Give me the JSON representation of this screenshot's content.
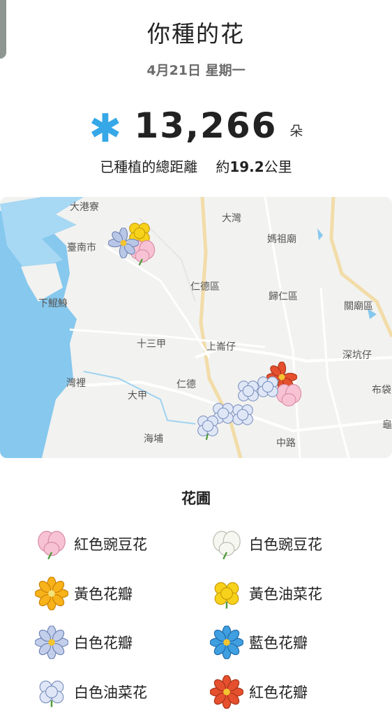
{
  "header": {
    "title": "你種的花",
    "date": "4月21日 星期一"
  },
  "stats": {
    "count": "13,266",
    "unit": "朵",
    "distance_label": "已種植的總距離",
    "distance_prefix": "約",
    "distance_value": "19.2",
    "distance_unit": "公里"
  },
  "map": {
    "labels": [
      "大港寮",
      "大灣",
      "臺南市",
      "媽祖廟",
      "仁德區",
      "下鯤鯓",
      "歸仁區",
      "關廟區",
      "十三甲",
      "上崙仔",
      "深坑仔",
      "灣裡",
      "仁德",
      "大甲",
      "布袋",
      "海埔",
      "中路",
      "龜"
    ]
  },
  "garden": {
    "title": "花圃",
    "items": [
      {
        "label": "紅色豌豆花",
        "icon": "pink-sweet-pea-icon"
      },
      {
        "label": "白色豌豆花",
        "icon": "white-sweet-pea-icon"
      },
      {
        "label": "黃色花瓣",
        "icon": "yellow-petal-flower-icon"
      },
      {
        "label": "黃色油菜花",
        "icon": "yellow-rapeseed-flower-icon"
      },
      {
        "label": "白色花瓣",
        "icon": "white-petal-flower-icon"
      },
      {
        "label": "藍色花瓣",
        "icon": "blue-petal-flower-icon"
      },
      {
        "label": "白色油菜花",
        "icon": "white-rapeseed-flower-icon"
      },
      {
        "label": "紅色花瓣",
        "icon": "red-petal-flower-icon"
      }
    ]
  }
}
